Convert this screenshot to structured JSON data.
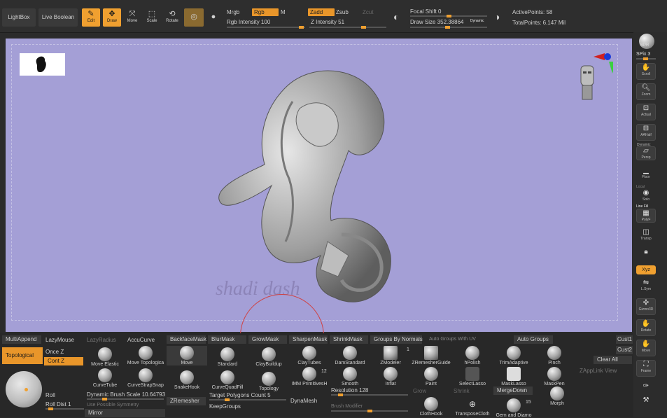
{
  "topbar": {
    "lightbox": "LightBox",
    "live_boolean": "Live Boolean",
    "edit": "Edit",
    "draw": "Draw",
    "move": "Move",
    "scale": "Scale",
    "rotate": "Rotate",
    "mrgb": "Mrgb",
    "rgb": "Rgb",
    "m": "M",
    "rgb_intensity": "Rgb Intensity 100",
    "zadd": "Zadd",
    "zsub": "Zsub",
    "zcut": "Zcut",
    "z_intensity": "Z Intensity 51",
    "focal_shift": "Focal Shift 0",
    "draw_size": "Draw Size 352.38864",
    "dynamic": "Dynamic",
    "active_points": "ActivePoints: 58",
    "total_points": "TotalPoints: 6.147 Mil",
    "accent_color": "#f0a030"
  },
  "viewport": {
    "background_color": "#a49fd6",
    "watermark": "shadi dash"
  },
  "rightbar": {
    "bpr": "BPR",
    "spix": "SPix 3",
    "scroll": "Scroll",
    "zoom": "Zoom",
    "actual": "Actual",
    "aahalf": "AAHalf",
    "dynamic": "Dynamic",
    "persp": "Persp",
    "floor": "Floor",
    "local": "Local",
    "solo": "Solo",
    "line_fill": "Line Fill",
    "polyf": "PolyF",
    "transp": "Transp",
    "xyz": "Xyz",
    "l_sym": "L.Sym",
    "gizmo": "Gizmo3D",
    "rotate": "Rotate",
    "move": "Move",
    "frame": "Frame"
  },
  "bottom": {
    "multiappend": "MultiAppend",
    "lazymouse": "LazyMouse",
    "lazyradius": "LazyRadius",
    "accucurve": "AccuCurve",
    "backfacemask": "BackfaceMask",
    "blurmask": "BlurMask",
    "growmask": "GrowMask",
    "sharpenmask": "SharpenMask",
    "shrinkmask": "ShrinkMask",
    "groups_by_normals": "Groups By Normals",
    "auto_groups_with_uv": "Auto Groups With UV",
    "auto_groups": "Auto Groups",
    "cust1": "Cust1",
    "cust2": "Cust2",
    "topological": "Topological",
    "once_z": "Once Z",
    "cont_z": "Cont Z",
    "roll": "Roll",
    "roll_dist": "Roll Dist 1",
    "dynamic_brush_scale": "Dynamic Brush Scale 10.64793",
    "use_possible_symmetry": "Use Possible Symmetry",
    "mirror": "Mirror",
    "zremesher": "ZRemesher",
    "target_polygons": "Target Polygons Count 5",
    "keepgroups": "KeepGroups",
    "dynamesh": "DynaMesh",
    "resolution": "Resolution 128",
    "brush_modifier": "Brush Modifier",
    "imm_count": "12",
    "zmodeler_count": "1",
    "gem_count": "15",
    "clear_all": "Clear All",
    "zapplink": "ZAppLink View",
    "grow": "Grow",
    "shrink": "Shrink",
    "mergedown": "MergeDown",
    "brushes": [
      "Move Elastic",
      "Move Topologica",
      "Move",
      "Standard",
      "ClayBuildup",
      "ClayTubes",
      "DamStandard",
      "ZModeler",
      "ZRemesherGuide",
      "hPolish",
      "TrimAdaptive",
      "Pinch",
      "CurveTube",
      "CurveStrapSnap",
      "SnakeHook",
      "CurveQuadFill",
      "Topology",
      "IMM PrimitivesH",
      "Smooth",
      "Inflat",
      "Paint",
      "SelectLasso",
      "MaskLasso",
      "MaskPen",
      "ClothHook",
      "TransposeCloth",
      "Gem and Diamo",
      "Morph"
    ]
  }
}
